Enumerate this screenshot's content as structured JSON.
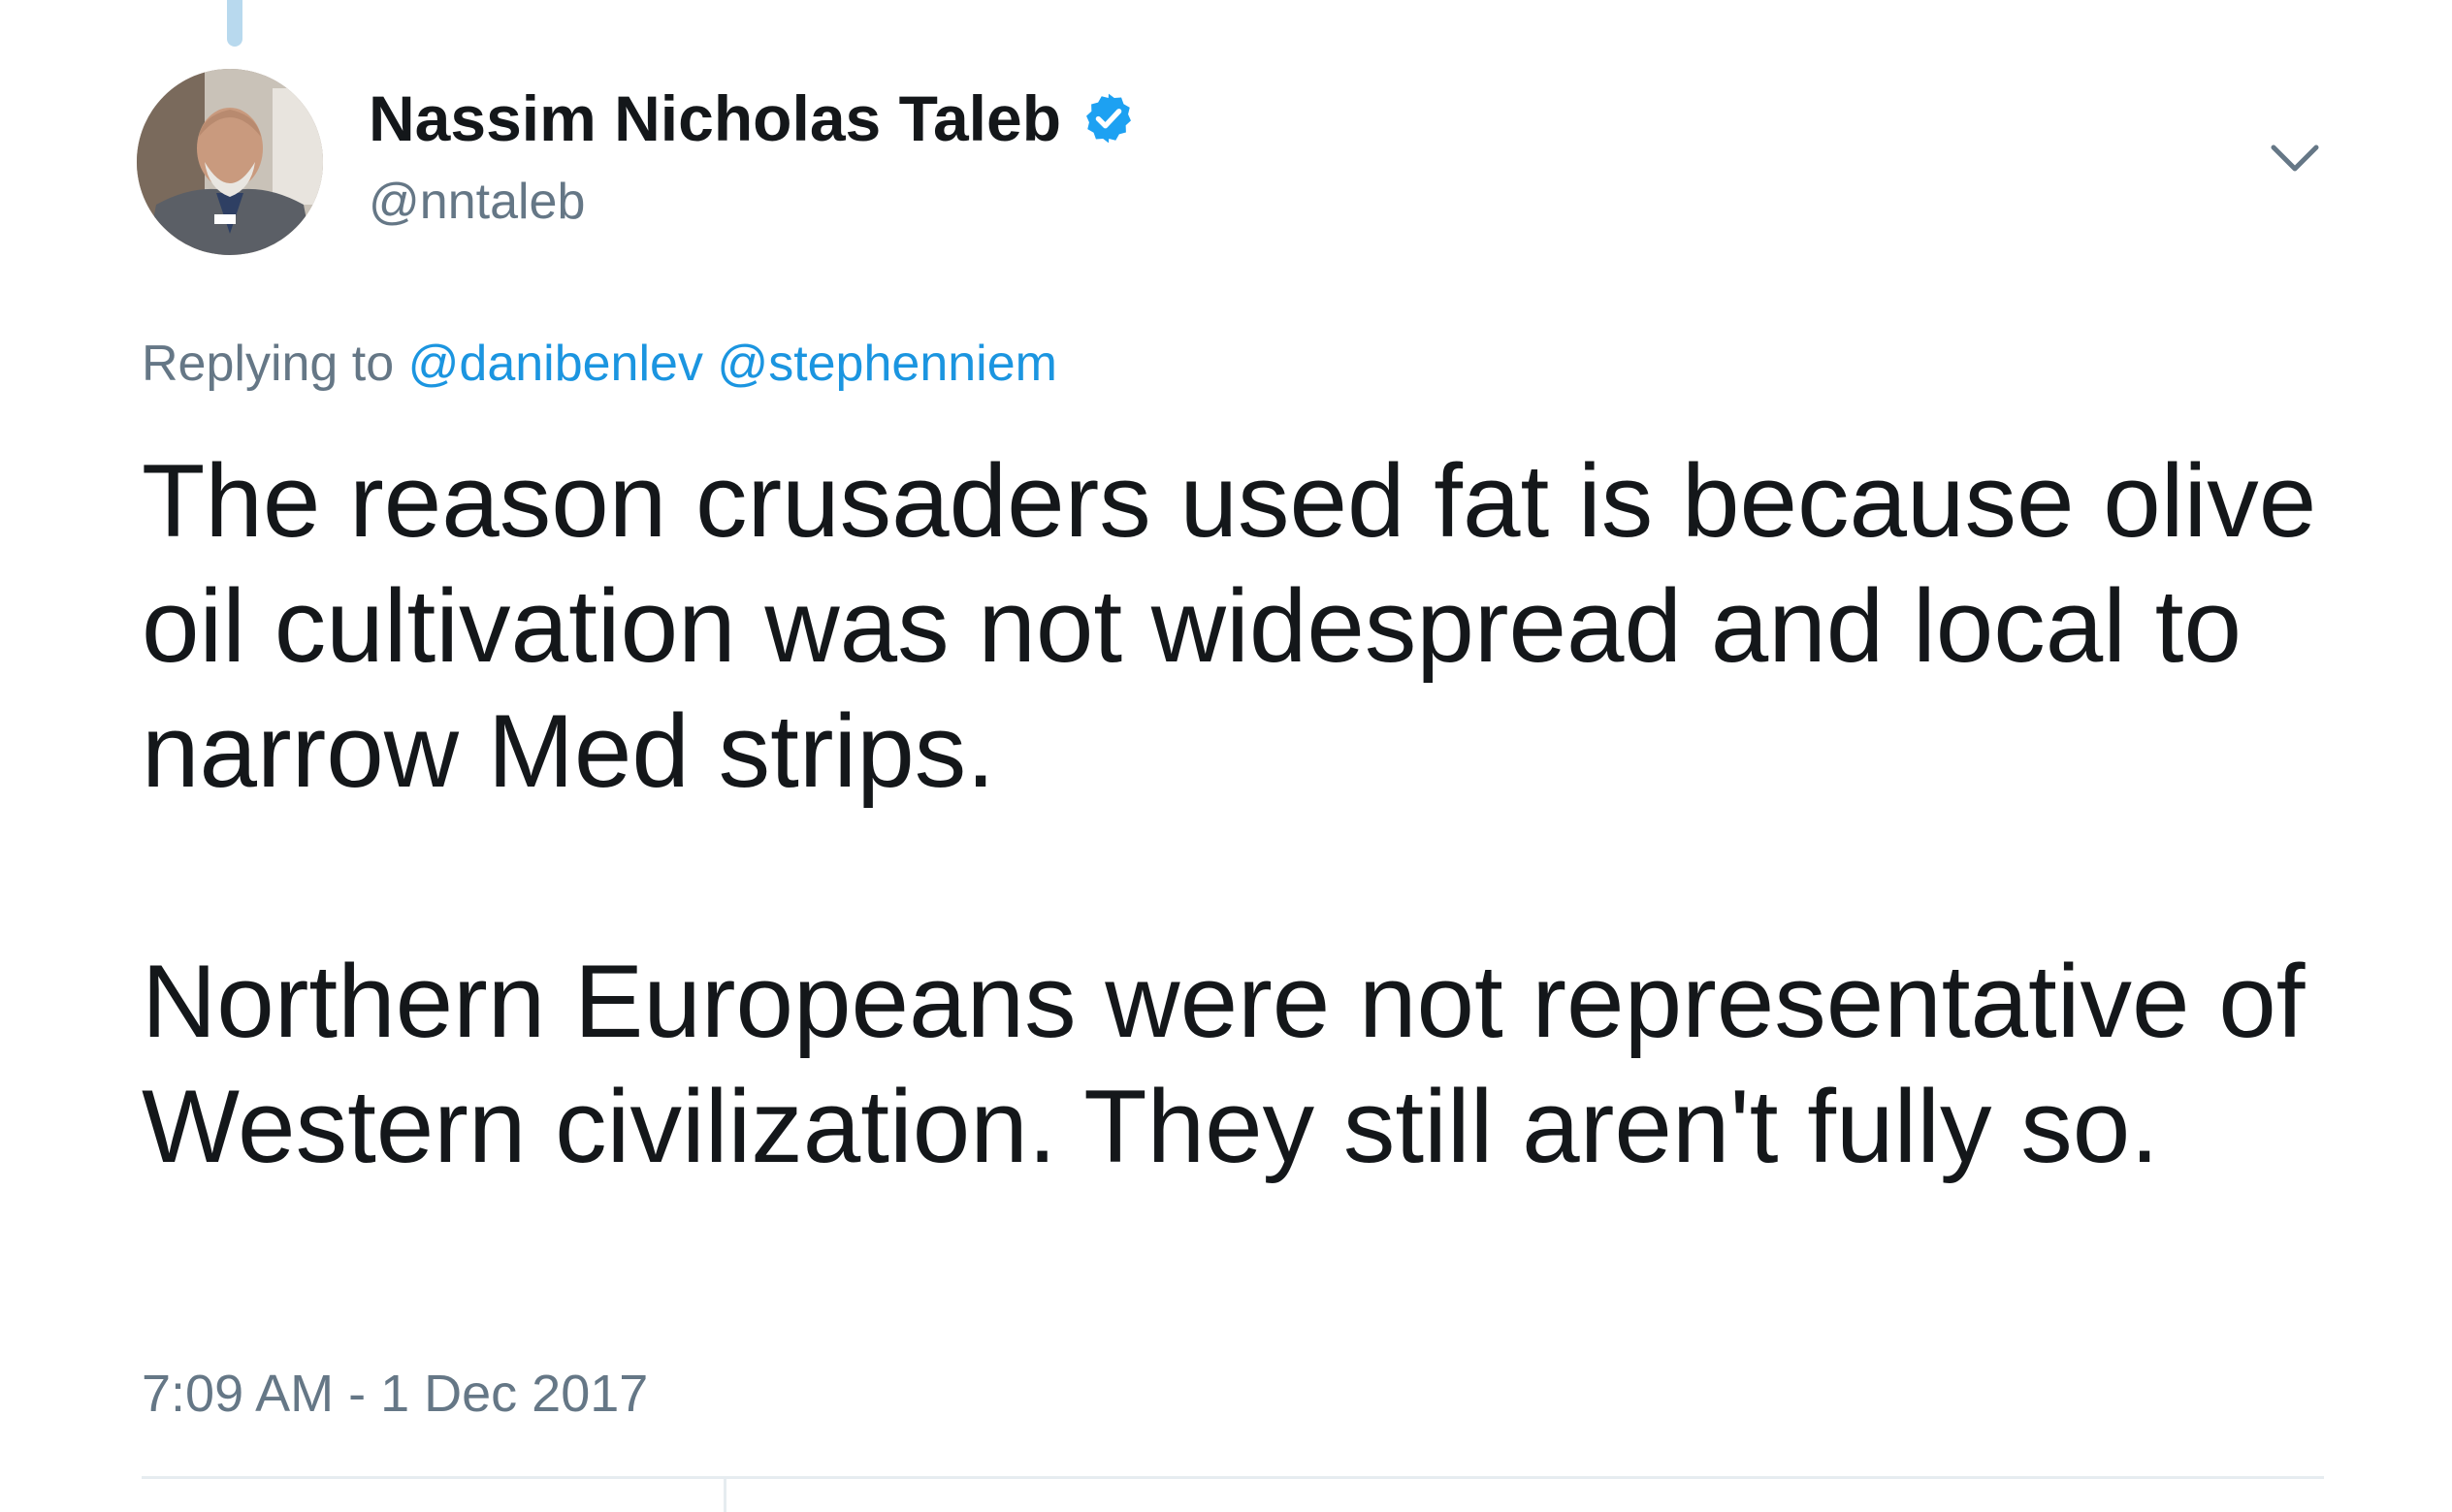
{
  "tweet": {
    "author": {
      "display_name": "Nassim Nicholas Taleb",
      "handle": "@nntaleb",
      "verified": true
    },
    "reply": {
      "prefix": "Replying to",
      "mentions": [
        "@danibenlev",
        "@stephenniem"
      ]
    },
    "text": {
      "paragraph1": "The reason crusaders used fat is because olive oil cultivation was not widespread and local to narrow Med strips.",
      "paragraph2": "Northern Europeans were not representative of Western civilization. They still aren't fully so."
    },
    "timestamp": "7:09 AM - 1 Dec 2017"
  },
  "icons": {
    "verified": "verified-badge-icon",
    "menu": "chevron-down-icon"
  },
  "colors": {
    "text_primary": "#14171a",
    "text_secondary": "#657786",
    "link": "#1b95e0",
    "verified_badge": "#1da1f2",
    "thread_line": "#b8d9ee",
    "divider": "#e6ecf0"
  }
}
